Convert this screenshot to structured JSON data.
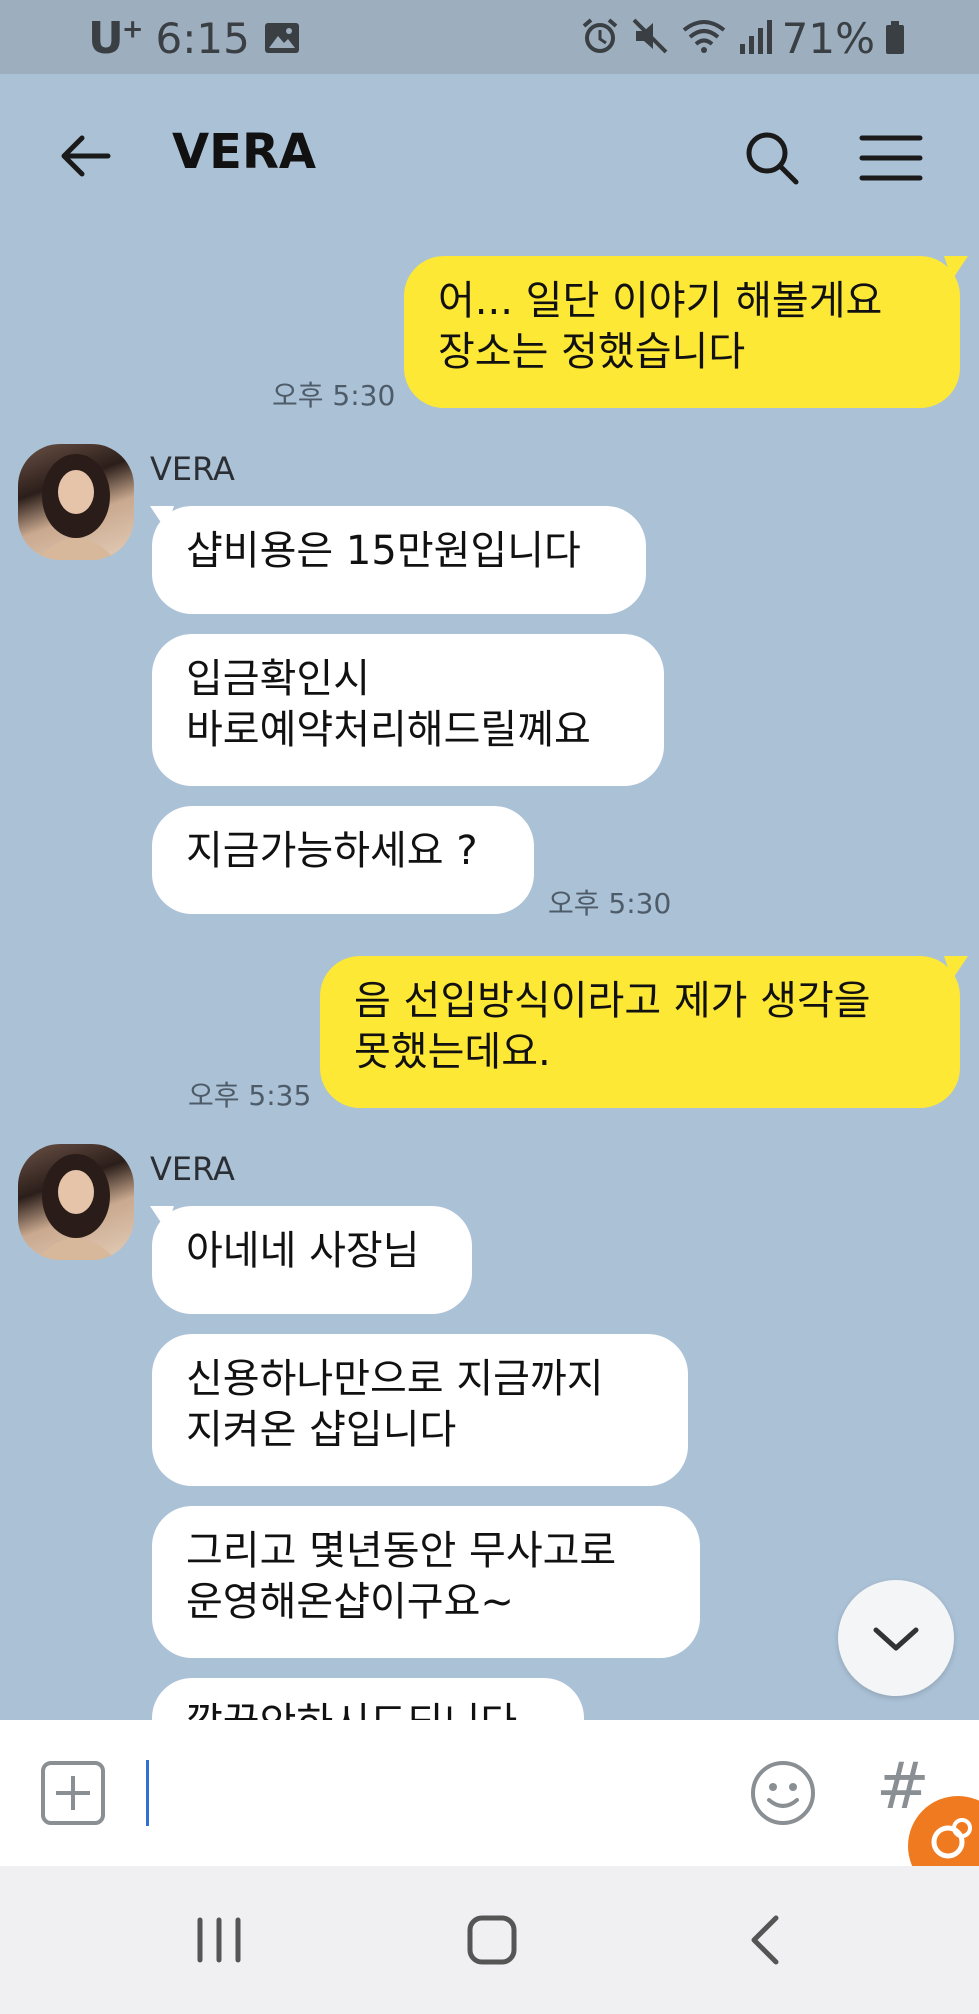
{
  "status_bar": {
    "carrier": "U",
    "carrier_plus": "+",
    "time": "6:15",
    "battery_percent": "71%"
  },
  "header": {
    "title": "VERA"
  },
  "messages": [
    {
      "direction": "out",
      "text": "어... 일단 이야기 해볼게요\n장소는 정했습니다",
      "time": "오후 5:30"
    },
    {
      "direction": "in",
      "sender": "VERA",
      "text": "샵비용은 15만원입니다"
    },
    {
      "direction": "in",
      "text": "입금확인시\n바로예약처리해드릴꼐요"
    },
    {
      "direction": "in",
      "text": "지금가능하세요 ?",
      "time": "오후 5:30"
    },
    {
      "direction": "out",
      "text": "음 선입방식이라고 제가 생각을\n못했는데요.",
      "time": "오후 5:35"
    },
    {
      "direction": "in",
      "sender": "VERA",
      "text": "아네네 사장님"
    },
    {
      "direction": "in",
      "text": "신용하나만으로 지금까지\n지켜온 샵입니다"
    },
    {
      "direction": "in",
      "text": "그리고 몇년동안 무사고로\n운영해온샵이구요~"
    },
    {
      "direction": "in",
      "text": "깔끔안하시드되니다"
    }
  ],
  "input": {
    "value": "",
    "placeholder": ""
  },
  "icons": {
    "back": "arrow-left-icon",
    "search": "search-icon",
    "menu": "hamburger-menu-icon",
    "attach": "plus-square-icon",
    "emoji": "smile-icon",
    "hash": "#",
    "scroll_down": "chevron-down-icon"
  },
  "colors": {
    "chat_background": "#abc1d6",
    "outgoing_bubble": "#fde835",
    "incoming_bubble": "#ffffff",
    "badge": "#f07a1f"
  }
}
